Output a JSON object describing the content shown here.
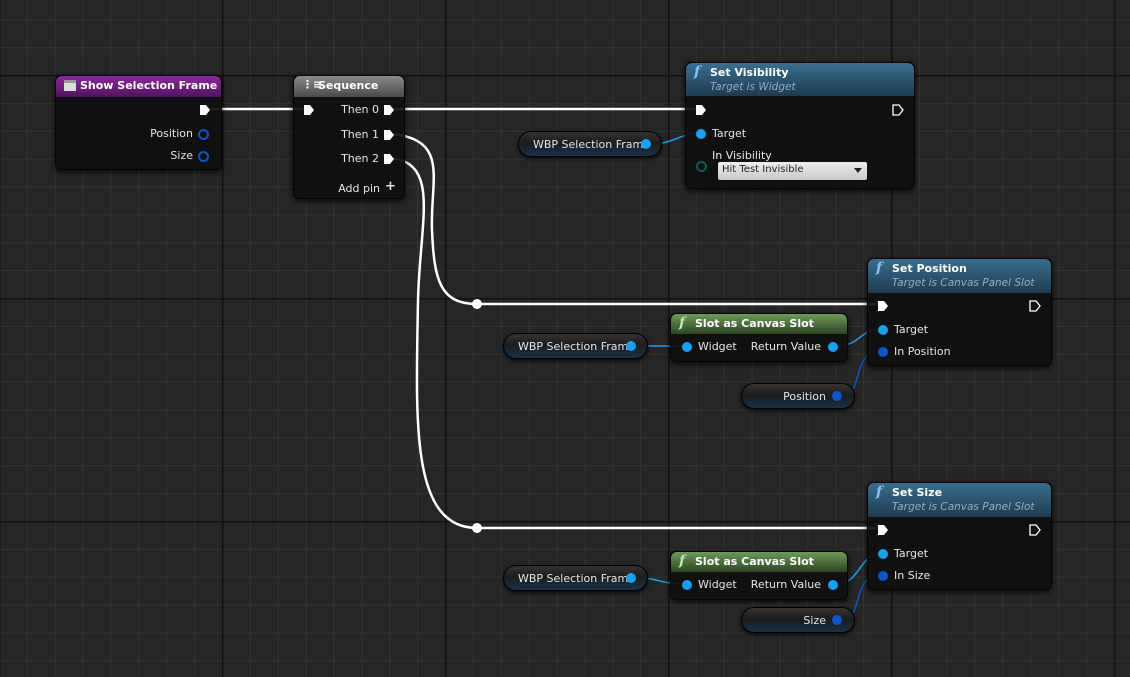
{
  "colors": {
    "exec_wire": "#ffffff",
    "object_wire": "#19a0f0",
    "struct_wire": "#0a55c8",
    "event_header": "#6a1b7a",
    "function_header": "#2e5f7d",
    "pure_header": "#4a6e3a",
    "sequence_header": "#666666"
  },
  "event": {
    "title": "Show Selection Frame",
    "icon": "event-icon",
    "outputs": [
      "Position",
      "Size"
    ]
  },
  "sequence": {
    "title": "Sequence",
    "icon": "sequence-icon",
    "outputs": [
      "Then 0",
      "Then 1",
      "Then 2"
    ],
    "add_pin": "Add pin"
  },
  "set_visibility": {
    "title": "Set Visibility",
    "subtitle": "Target is Widget",
    "target": "Target",
    "in_visibility": "In Visibility",
    "visibility_value": "Hit Test Invisible"
  },
  "set_position": {
    "title": "Set Position",
    "subtitle": "Target is Canvas Panel Slot",
    "target": "Target",
    "input": "In Position"
  },
  "set_size": {
    "title": "Set Size",
    "subtitle": "Target is Canvas Panel Slot",
    "target": "Target",
    "input": "In Size"
  },
  "slot_cast": {
    "title": "Slot as Canvas Slot",
    "input": "Widget",
    "output": "Return Value"
  },
  "variables": {
    "widget": "WBP Selection Frame",
    "position": "Position",
    "size": "Size"
  }
}
